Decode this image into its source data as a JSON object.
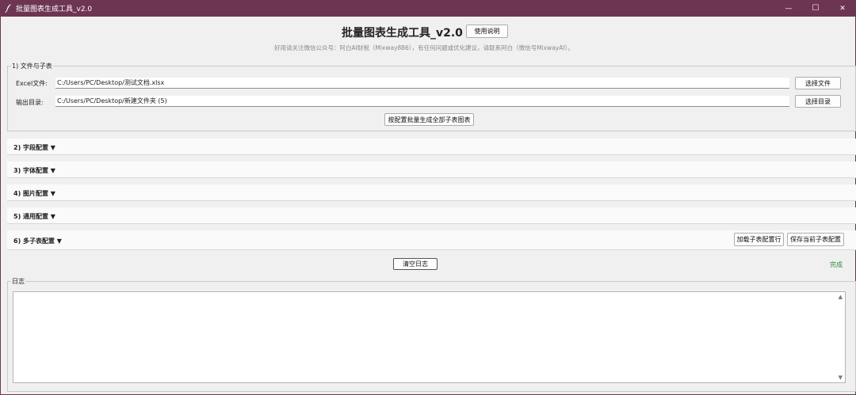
{
  "window": {
    "title": "批量图表生成工具_v2.0",
    "controls": {
      "minimize": "—",
      "maximize": "☐",
      "close": "✕"
    }
  },
  "header": {
    "title": "批量图表生成工具_v2.0",
    "help_label": "使用说明",
    "subtitle": "好用请关注微信公众号：阿白AI财税（Mixway886），有任何问题或优化建议，请联系阿白（微信号MixwayAI）。"
  },
  "files_group": {
    "label": "1) 文件与子表",
    "excel_label": "Excel文件:",
    "excel_value": "C:/Users/PC/Desktop/测试文档.xlsx",
    "choose_file_label": "选择文件",
    "output_label": "输出目录:",
    "output_value": "C:/Users/PC/Desktop/新建文件夹 (5)",
    "choose_dir_label": "选择目录",
    "generate_label": "按配置批量生成全部子表图表"
  },
  "sections": [
    {
      "label": "2) 字段配置 ▼"
    },
    {
      "label": "3) 字体配置 ▼"
    },
    {
      "label": "4) 图片配置 ▼"
    },
    {
      "label": "5) 通用配置 ▼"
    },
    {
      "label": "6) 多子表配置 ▼"
    }
  ],
  "multi_sheet": {
    "load_label": "加载子表配置行",
    "save_label": "保存当前子表配置"
  },
  "log": {
    "clear_label": "清空日志",
    "status": "完成",
    "label": "日志",
    "content": ""
  },
  "colors": {
    "titlebar": "#6e3553",
    "background": "#f0f0f0",
    "status": "#2d8a3e"
  }
}
